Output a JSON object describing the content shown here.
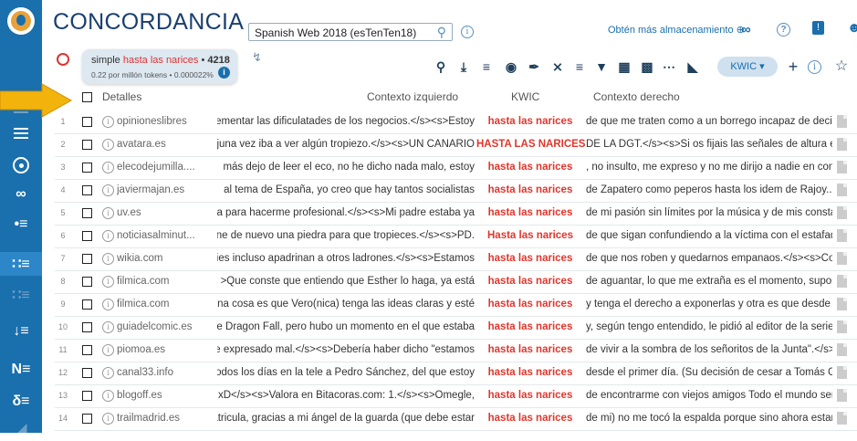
{
  "app": {
    "title": "CONCORDANCIA"
  },
  "corpus": {
    "name": "Spanish Web 2018 (esTenTen18)"
  },
  "header": {
    "storage_link": "Obtén más almacenamiento"
  },
  "query": {
    "prefix": "simple",
    "term": "hasta las narices",
    "separator": "•",
    "count": "4218",
    "stats": "0.22 por millón tokens • 0.000022%"
  },
  "toolbar": {
    "view_mode": "KWIC"
  },
  "table": {
    "headers": {
      "details": "Detalles",
      "left": "Contexto izquierdo",
      "kwic": "KWIC",
      "right": "Contexto derecho"
    },
    "rows": [
      {
        "num": "1",
        "source": "opinioneslibres",
        "left": "ementar las dificulatades de los negocios.</s><s>Estoy",
        "kwic": "hasta las narices",
        "right": "de que me traten como a un borrego incapaz de decidir"
      },
      {
        "num": "2",
        "source": "avatara.es",
        "left": "juna vez iba a ver algún tropiezo.</s><s>UN CANARIO",
        "kwic": "HASTA LAS NARICES",
        "right": "DE LA DGT.</s><s>Si os fijais las señales de altura es"
      },
      {
        "num": "3",
        "source": "elecodejumilla....",
        "left": "más dejo de leer el eco, no he dicho nada malo, estoy",
        "kwic": "hasta las narices",
        "right": ", no insulto, me expreso y no me dirijo a nadie en concr"
      },
      {
        "num": "4",
        "source": "javiermajan.es",
        "left": "al tema de España, yo creo que hay tantos socialistas",
        "kwic": "hasta las narices",
        "right": "de Zapatero como peperos hasta los idem de Rajoy...p"
      },
      {
        "num": "5",
        "source": "uv.es",
        "left": "a para hacerme profesional.</s><s>Mi padre estaba ya",
        "kwic": "hasta las narices",
        "right": "de mi pasión sin límites por la música y de mis constan"
      },
      {
        "num": "6",
        "source": "noticiasalminut...",
        "left": "ne de nuevo una piedra para que tropieces.</s><s>PD.",
        "kwic": "Hasta las narices",
        "right": "de que sigan confundiendo a la víctima con el estafado"
      },
      {
        "num": "7",
        "source": "wikia.com",
        "left": "ies incluso apadrinan a otros ladrones.</s><s>Estamos",
        "kwic": "hasta las narices",
        "right": "de que nos roben y quedarnos empanaos.</s><s>Con"
      },
      {
        "num": "8",
        "source": "filmica.com",
        "left": ">Que conste que entiendo que Esther lo haga, ya está",
        "kwic": "hasta las narices",
        "right": "de aguantar, lo que me extraña es el momento, supong"
      },
      {
        "num": "9",
        "source": "filmica.com",
        "left": "na cosa es que Vero(nica) tenga las ideas claras y esté",
        "kwic": "hasta las narices",
        "right": "y tenga el derecho a exponerlas y otra es que desde m"
      },
      {
        "num": "10",
        "source": "guiadelcomic.es",
        "left": "e Dragon Fall, pero hubo un momento en el que estaba",
        "kwic": "hasta las narices",
        "right": "y, según tengo entendido, le pidió al editor de la serie u"
      },
      {
        "num": "11",
        "source": "piomoa.es",
        "left": "e expresado mal.</s><s>Debería haber dicho \"estamos",
        "kwic": "hasta las narices",
        "right": "de vivir a la sombra de los señoritos de la Junta\".</s><"
      },
      {
        "num": "12",
        "source": "canal33.info",
        "left": "odos los días en la tele a Pedro Sánchez, del que estoy",
        "kwic": "hasta las narices",
        "right": "desde el primer día. (Su decisión de cesar a Tomás Gó"
      },
      {
        "num": "13",
        "source": "blogoff.es",
        "left": "xD</s><s>Valora en Bitacoras.com: 1.</s><s>Omegle,",
        "kwic": "hasta las narices",
        "right": "de encontrarme con viejos amigos Todo el mundo seña"
      },
      {
        "num": "14",
        "source": "trailmadrid.es",
        "left": "atricula, gracias a mi ángel de la guarda (que debe estar",
        "kwic": "hasta las narices",
        "right": "de mi) no me tocó la espalda porque sino ahora estaría"
      }
    ]
  }
}
